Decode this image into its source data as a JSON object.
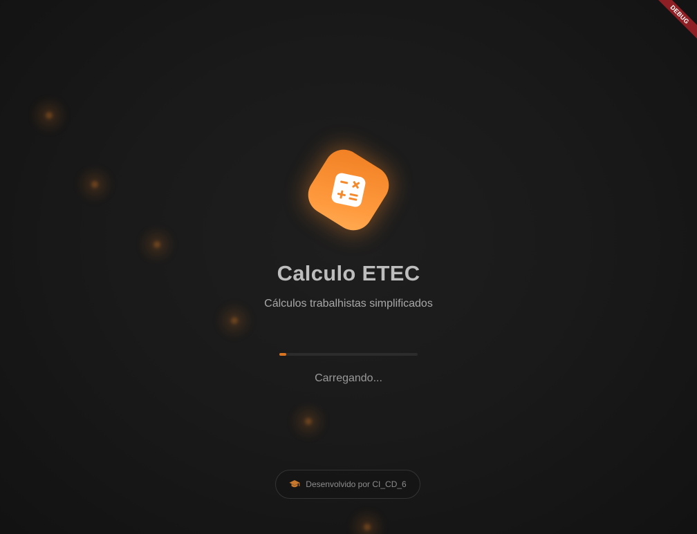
{
  "app": {
    "title": "Calculo ETEC",
    "subtitle": "Cálculos trabalhistas simplificados",
    "logo_icon": "calculator-icon"
  },
  "debug_banner": {
    "label": "DEBUG"
  },
  "loading": {
    "text": "Carregando...",
    "progress_percent": 5
  },
  "footer": {
    "icon": "graduation-cap-icon",
    "text": "Desenvolvido por CI_CD_6"
  },
  "colors": {
    "accent": "#f58a2c",
    "background": "#1a1a1a",
    "debug": "#8e1f24"
  }
}
